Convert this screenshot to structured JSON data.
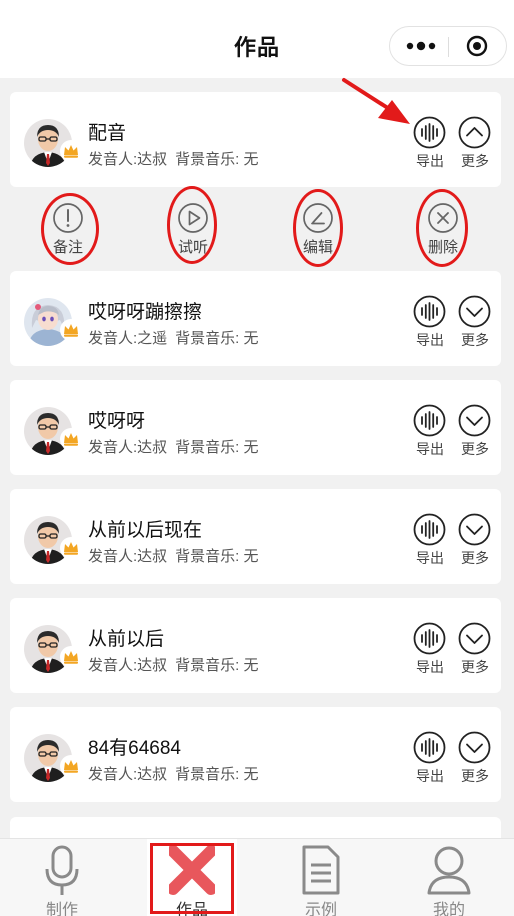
{
  "header": {
    "title": "作品"
  },
  "works": [
    {
      "title": "配音",
      "speaker": "发音人:达叔",
      "bgm": "背景音乐: 无",
      "avatar": "man-avatar",
      "expanded": true
    },
    {
      "title": "哎呀呀蹦擦擦",
      "speaker": "发音人:之遥",
      "bgm": "背景音乐: 无",
      "avatar": "girl-avatar",
      "expanded": false
    },
    {
      "title": "哎呀呀",
      "speaker": "发音人:达叔",
      "bgm": "背景音乐: 无",
      "avatar": "man-avatar",
      "expanded": false
    },
    {
      "title": "从前以后现在",
      "speaker": "发音人:达叔",
      "bgm": "背景音乐: 无",
      "avatar": "man-avatar",
      "expanded": false
    },
    {
      "title": "从前以后",
      "speaker": "发音人:达叔",
      "bgm": "背景音乐: 无",
      "avatar": "man-avatar",
      "expanded": false
    },
    {
      "title": "84有64684",
      "speaker": "发音人:达叔",
      "bgm": "背景音乐: 无",
      "avatar": "man-avatar",
      "expanded": false
    }
  ],
  "item_buttons": {
    "export": "导出",
    "more": "更多"
  },
  "actions": [
    {
      "label": "备注",
      "icon": "exclamation-icon"
    },
    {
      "label": "试听",
      "icon": "play-icon"
    },
    {
      "label": "编辑",
      "icon": "edit-icon"
    },
    {
      "label": "删除",
      "icon": "close-icon"
    }
  ],
  "tabbar": [
    {
      "label": "制作",
      "icon": "microphone-icon"
    },
    {
      "label": "作品",
      "icon": "works-icon",
      "active": true
    },
    {
      "label": "示例",
      "icon": "document-icon"
    },
    {
      "label": "我的",
      "icon": "user-icon"
    }
  ],
  "colors": {
    "accent": "#e21a1a",
    "background": "#f1f1f1",
    "card": "#ffffff",
    "muted_text": "#555555"
  }
}
